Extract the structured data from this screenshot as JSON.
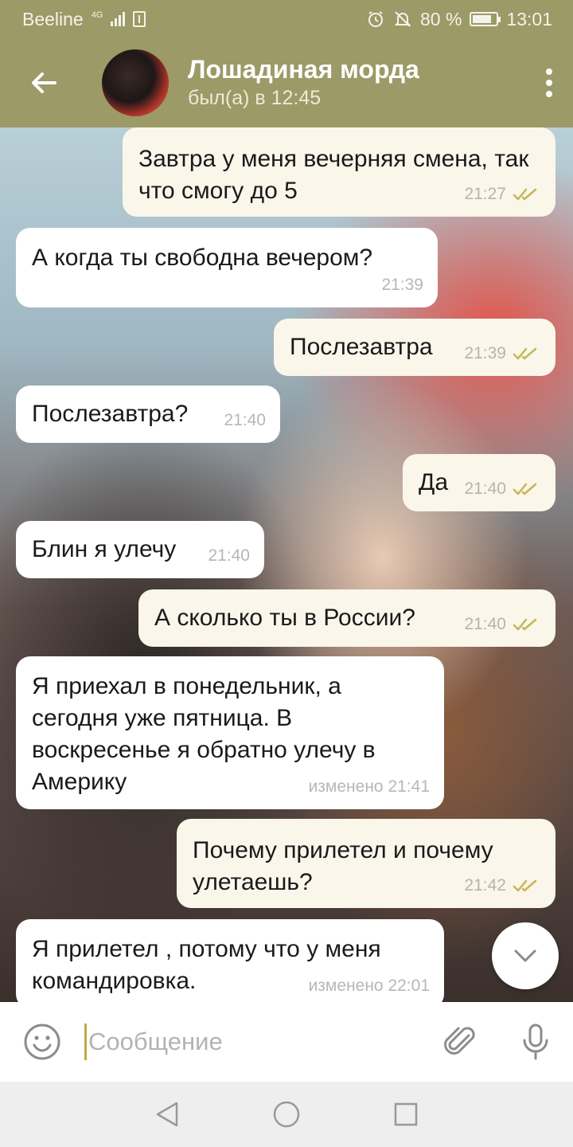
{
  "status_bar": {
    "carrier": "Beeline",
    "network": "4G",
    "battery": "80 %",
    "time": "13:01"
  },
  "header": {
    "contact_name": "Лошадиная морда",
    "last_seen": "был(а) в 12:45"
  },
  "messages": [
    {
      "dir": "out",
      "text": "Завтра у меня вечерняя смена, так что смогу до 5",
      "time": "21:27",
      "edited": ""
    },
    {
      "dir": "in",
      "text": "А когда ты свободна вечером?",
      "time": "21:39",
      "edited": ""
    },
    {
      "dir": "out",
      "text": "Послезавтра",
      "time": "21:39",
      "edited": ""
    },
    {
      "dir": "in",
      "text": "Послезавтра?",
      "time": "21:40",
      "edited": ""
    },
    {
      "dir": "out",
      "text": "Да",
      "time": "21:40",
      "edited": ""
    },
    {
      "dir": "in",
      "text": "Блин я улечу",
      "time": "21:40",
      "edited": ""
    },
    {
      "dir": "out",
      "text": "А сколько ты в России?",
      "time": "21:40",
      "edited": ""
    },
    {
      "dir": "in",
      "text": "Я приехал в понедельник, а сегодня уже пятница. В воскресенье я обратно улечу в Америку",
      "time": "изменено 21:41",
      "edited": "изменено"
    },
    {
      "dir": "out",
      "text": "Почему прилетел и почему улетаешь?",
      "time": "21:42",
      "edited": ""
    },
    {
      "dir": "in",
      "text": "Я прилетел , потому что у меня командировка.",
      "time": "изменено 22:01",
      "edited": "изменено"
    }
  ],
  "input": {
    "placeholder": "Сообщение",
    "value": ""
  },
  "colors": {
    "header_bg": "#9c9a66",
    "outgoing_bubble": "#faf6ea",
    "incoming_bubble": "#ffffff",
    "read_tick": "#c8b45a"
  },
  "icons": {
    "back": "arrow-left-icon",
    "menu": "more-vertical-icon",
    "emoji": "smile-icon",
    "attach": "paperclip-icon",
    "mic": "microphone-icon",
    "scroll_down": "chevron-down-icon",
    "nav_back": "triangle-back-icon",
    "nav_home": "circle-home-icon",
    "nav_recents": "square-recents-icon"
  }
}
